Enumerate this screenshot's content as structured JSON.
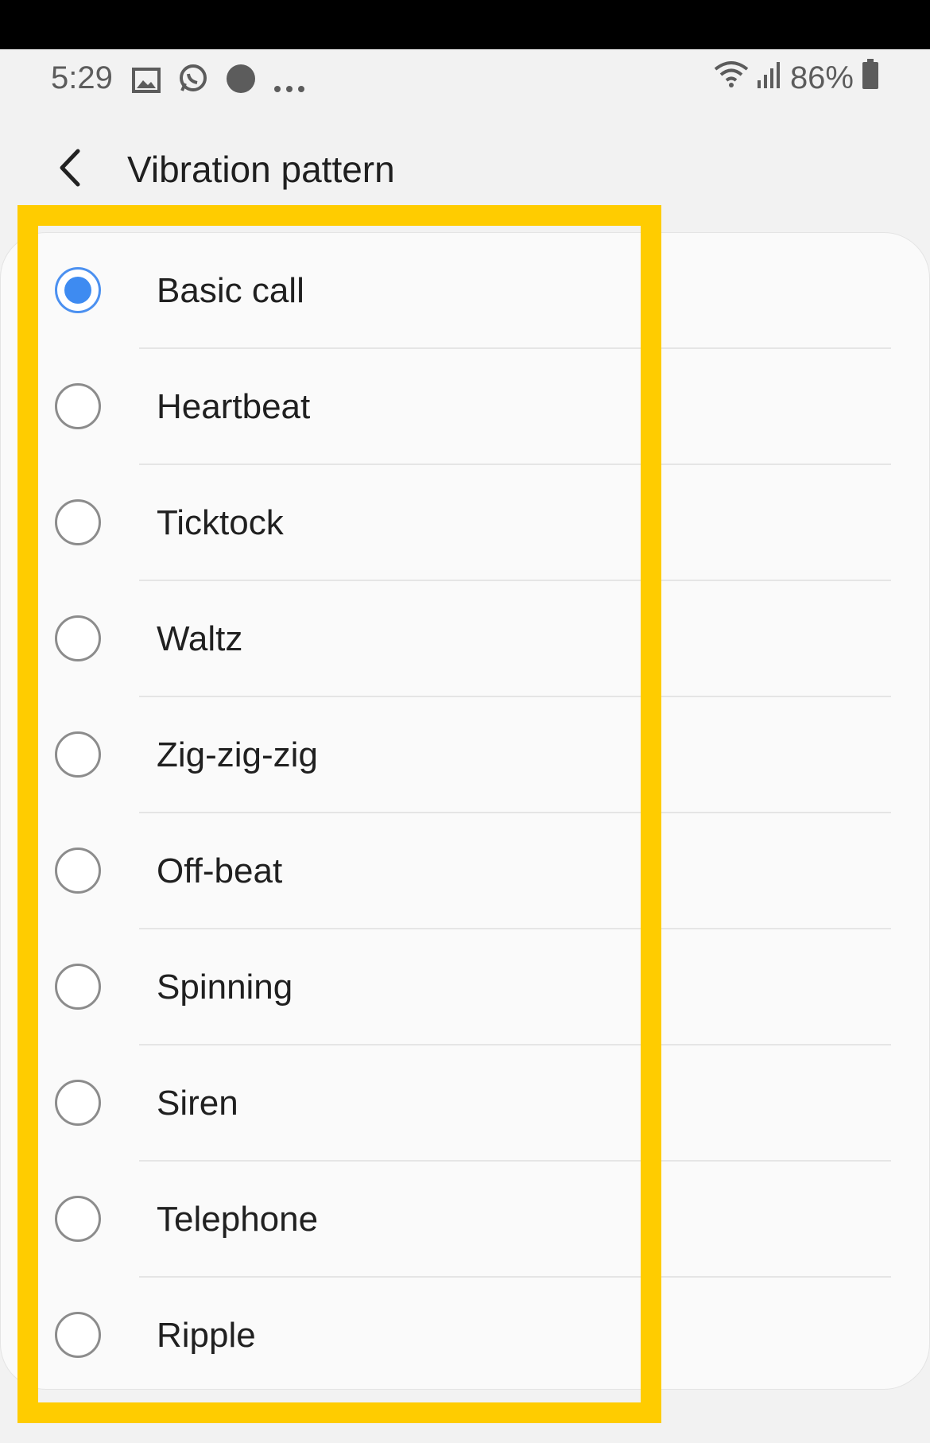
{
  "status_bar": {
    "time": "5:29",
    "left_icons": [
      "image-icon",
      "whatsapp-icon",
      "app-notification-icon",
      "more-dots-icon"
    ],
    "battery_percent": "86%",
    "right_icons": [
      "wifi-icon",
      "signal-icon",
      "battery-icon"
    ]
  },
  "header": {
    "title": "Vibration pattern",
    "back_icon": "chevron-left-icon"
  },
  "patterns": [
    {
      "label": "Basic call",
      "selected": true
    },
    {
      "label": "Heartbeat",
      "selected": false
    },
    {
      "label": "Ticktock",
      "selected": false
    },
    {
      "label": "Waltz",
      "selected": false
    },
    {
      "label": "Zig-zig-zig",
      "selected": false
    },
    {
      "label": "Off-beat",
      "selected": false
    },
    {
      "label": "Spinning",
      "selected": false
    },
    {
      "label": "Siren",
      "selected": false
    },
    {
      "label": "Telephone",
      "selected": false
    },
    {
      "label": "Ripple",
      "selected": false
    }
  ],
  "colors": {
    "accent": "#3e8bf1",
    "highlight": "#ffcc00"
  }
}
